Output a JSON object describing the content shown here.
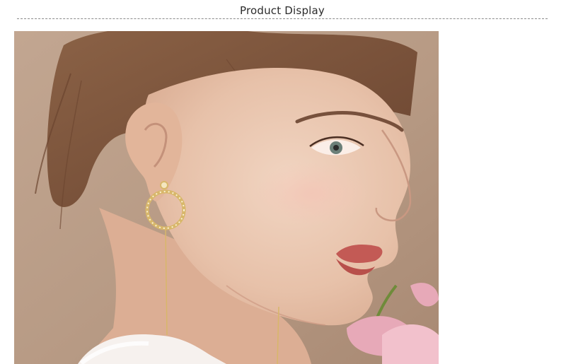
{
  "header": {
    "title": "Product Display"
  },
  "photo": {
    "subject": "woman-profile-wearing-earring",
    "colors": {
      "background": "#b89a84",
      "skin": "#e9c7b0",
      "hair": "#7a5238",
      "lips": "#c35a55",
      "earring_gold": "#d8b76a",
      "fur": "#f6f1ee",
      "flower": "#e7a9b8"
    }
  }
}
